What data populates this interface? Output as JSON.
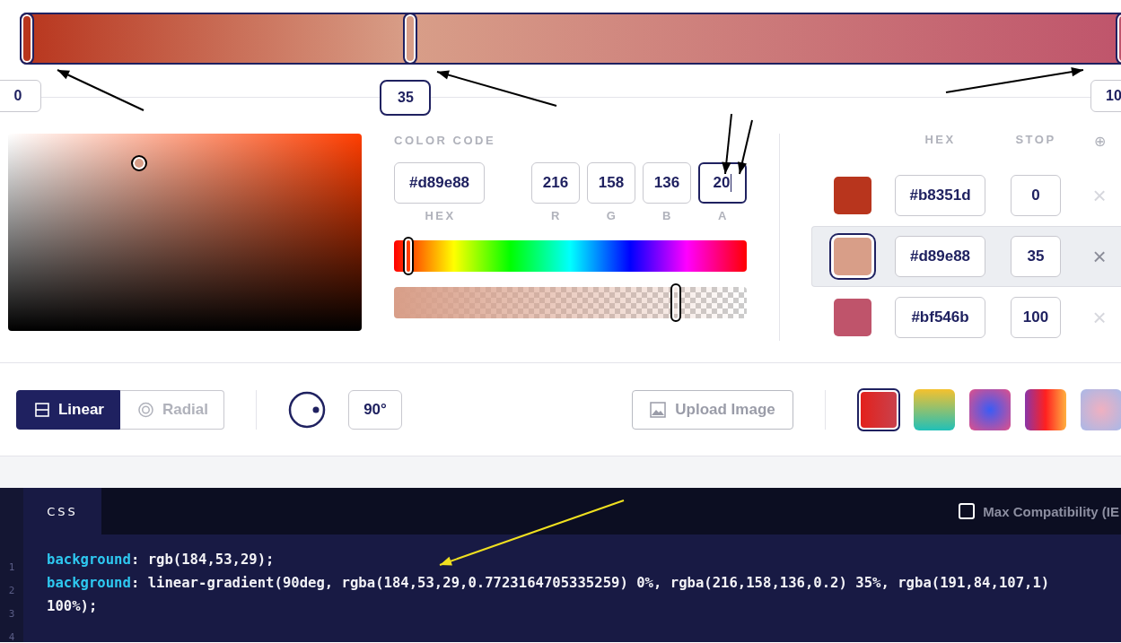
{
  "stops": [
    {
      "color": "#b8351d",
      "hex": "#b8351d",
      "stop": "0",
      "handle_label": "0",
      "level": 0,
      "selected": false
    },
    {
      "color": "#d89e88",
      "hex": "#d89e88",
      "stop": "35",
      "handle_label": "35",
      "level": 0.35,
      "selected": true
    },
    {
      "color": "#bf546b",
      "hex": "#bf546b",
      "stop": "100",
      "handle_label": "10",
      "level": 1,
      "selected": false
    }
  ],
  "picker": {
    "saturation": {
      "level": 0.37
    },
    "hue": {
      "level": 0.04
    },
    "alpha": {
      "level": 0.8
    }
  },
  "color_code": {
    "title": "COLOR CODE",
    "hex": {
      "value": "#d89e88",
      "label": "HEX"
    },
    "channels": [
      {
        "value": "216",
        "label": "R",
        "focused": false
      },
      {
        "value": "158",
        "label": "G",
        "focused": false
      },
      {
        "value": "136",
        "label": "B",
        "focused": false
      },
      {
        "value": "20",
        "label": "A",
        "focused": true
      }
    ]
  },
  "stop_table": {
    "columns": [
      "HEX",
      "STOP"
    ],
    "add_icon": "⊕",
    "delete_icon": "×"
  },
  "gradient_types": [
    {
      "kind": "linear",
      "label": "Linear",
      "selected": true
    },
    {
      "kind": "radial",
      "label": "Radial",
      "selected": false
    }
  ],
  "angle": "90°",
  "upload_button": "Upload Image",
  "presets": [
    {
      "kind": "picture",
      "selected": true
    },
    {
      "kind": "picture",
      "selected": false
    },
    {
      "kind": "picture",
      "selected": false
    },
    {
      "kind": "picture",
      "selected": false
    },
    {
      "kind": "picture",
      "selected": false
    }
  ],
  "code": {
    "tab": "CSS",
    "compatibility": {
      "label": "Max Compatibility (IE",
      "checked": false
    },
    "lines": [
      {
        "number": "1",
        "property": "background",
        "text": ": rgb(184,53,29);"
      },
      {
        "number": "2",
        "property": "background",
        "text": ": linear-gradient(90deg, rgba(184,53,29,0.7723164705335259) 0%, rgba(216,158,136,0.2) 35%, rgba(191,84,107,1)"
      },
      {
        "number": "3",
        "text": "100%);"
      },
      {
        "number": "4"
      }
    ]
  }
}
